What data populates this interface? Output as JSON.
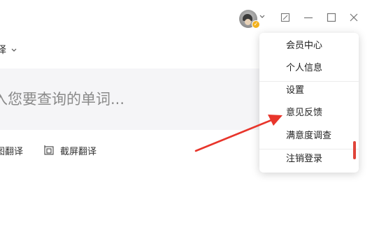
{
  "window": {
    "avatar_alt": "user avatar",
    "vip_badge": "✓",
    "icons": {
      "avatar_menu": "chevron-down-icon",
      "compact": "compact-mode-icon",
      "minimize": "minimize-icon",
      "maximize": "maximize-icon",
      "close": "close-icon"
    }
  },
  "toolbar": {
    "language_label": "译",
    "language_icon": "chevron-down-icon"
  },
  "search": {
    "placeholder": "入您要查询的单词..."
  },
  "tools": [
    {
      "label": "图翻译",
      "icon": "image-translate-icon"
    },
    {
      "label": "截屏翻译",
      "icon": "screenshot-translate-icon"
    }
  ],
  "menu": {
    "items": [
      {
        "label": "会员中心"
      },
      {
        "label": "个人信息"
      },
      {
        "label": "设置"
      },
      {
        "label": "意见反馈"
      },
      {
        "label": "满意度调查"
      },
      {
        "label": "注销登录"
      }
    ]
  },
  "colors": {
    "accent_red": "#e0443a",
    "vip_gold": "#f2b21f",
    "search_bg": "#f5f5f7"
  }
}
